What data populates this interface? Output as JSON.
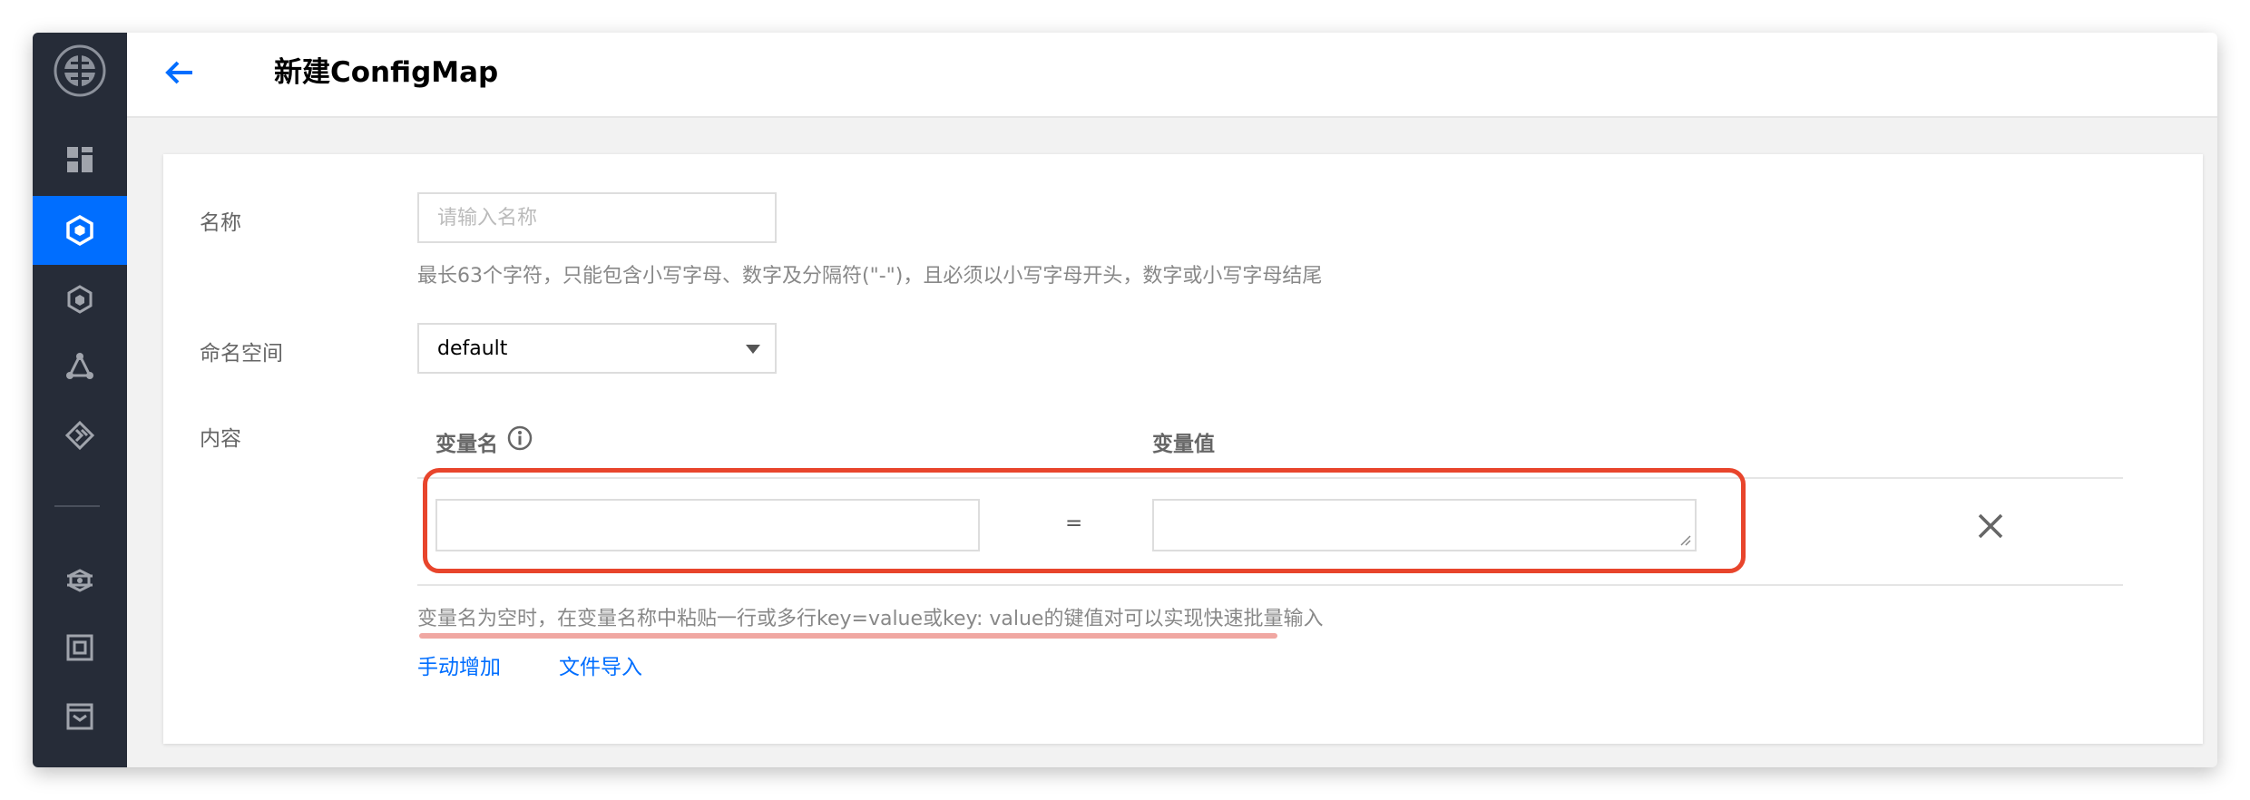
{
  "header": {
    "title": "新建ConfigMap",
    "back_icon": "arrow-left-icon"
  },
  "sidebar": {
    "items": [
      {
        "icon": "dashboard-grid-icon",
        "active": false
      },
      {
        "icon": "cluster-hexagon-icon",
        "active": true
      },
      {
        "icon": "cube-icon",
        "active": false
      },
      {
        "icon": "network-nodes-icon",
        "active": false
      },
      {
        "icon": "service-diamond-icon",
        "active": false
      },
      {
        "icon": "ship-wheel-icon",
        "active": false
      },
      {
        "icon": "storage-box-icon",
        "active": false
      },
      {
        "icon": "inbox-icon",
        "active": false
      }
    ]
  },
  "form": {
    "name_label": "名称",
    "name_placeholder": "请输入名称",
    "name_hint": "最长63个字符，只能包含小写字母、数字及分隔符(\"-\")，且必须以小写字母开头，数字或小写字母结尾",
    "namespace_label": "命名空间",
    "namespace_value": "default",
    "content_label": "内容",
    "var_name_header": "变量名",
    "var_value_header": "变量值",
    "equals": "=",
    "tip": "变量名为空时，在变量名称中粘贴一行或多行key=value或key: value的键值对可以实现快速批量输入",
    "add_manual": "手动增加",
    "import_file": "文件导入"
  },
  "colors": {
    "accent": "#006eff",
    "sidebar_bg": "#262c38",
    "highlight": "#e8452c"
  }
}
